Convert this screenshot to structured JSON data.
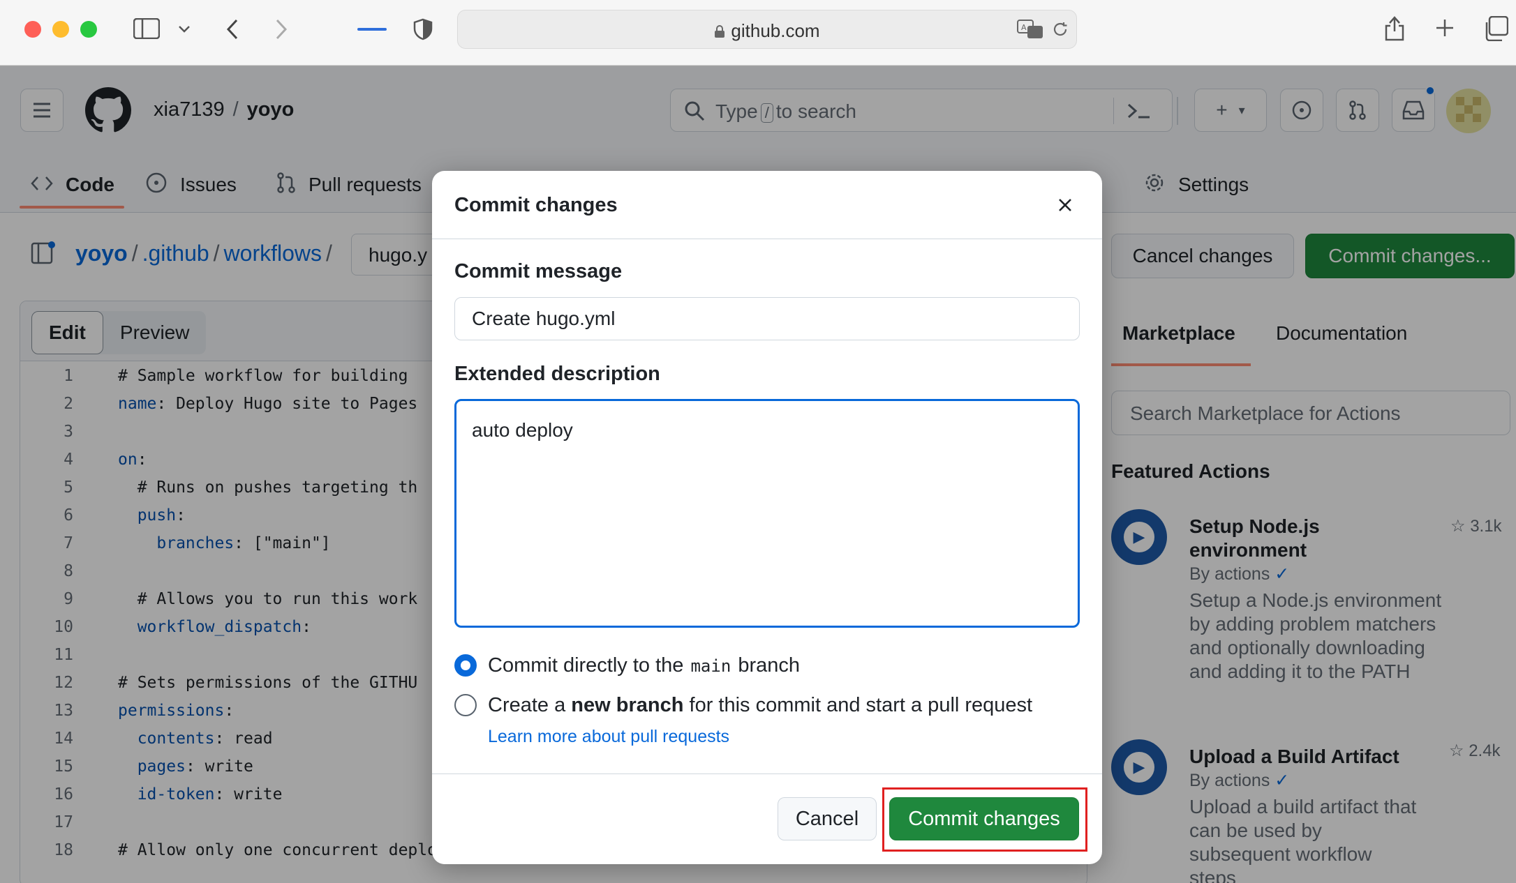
{
  "browser": {
    "url": "github.com"
  },
  "repo": {
    "owner": "xia7139",
    "separator": "/",
    "name": "yoyo"
  },
  "search": {
    "placeholder_before": "Type",
    "slash_key": "/",
    "placeholder_after": "to search"
  },
  "tabs": [
    {
      "label": "Code",
      "icon": "code-icon"
    },
    {
      "label": "Issues",
      "icon": "issue-icon"
    },
    {
      "label": "Pull requests",
      "icon": "pull-request-icon"
    },
    {
      "label": "Settings",
      "icon": "gear-icon"
    }
  ],
  "breadcrumb": {
    "repo": "yoyo",
    "dir1": ".github",
    "dir2": "workflows",
    "sep": "/",
    "filename_visible": "hugo.y"
  },
  "actions": {
    "cancel_changes": "Cancel changes",
    "commit_changes": "Commit changes..."
  },
  "editor": {
    "edit_tab": "Edit",
    "preview_tab": "Preview",
    "lines": [
      {
        "n": "1",
        "text": "# Sample workflow for building"
      },
      {
        "n": "2",
        "key": "name",
        "rest": ": Deploy Hugo site to Pages"
      },
      {
        "n": "3",
        "text": ""
      },
      {
        "n": "4",
        "key": "on",
        "rest": ":"
      },
      {
        "n": "5",
        "text": "  # Runs on pushes targeting th"
      },
      {
        "n": "6",
        "indent": "  ",
        "key": "push",
        "rest": ":"
      },
      {
        "n": "7",
        "indent": "    ",
        "key": "branches",
        "rest": ": [\"main\"]"
      },
      {
        "n": "8",
        "text": ""
      },
      {
        "n": "9",
        "text": "  # Allows you to run this work"
      },
      {
        "n": "10",
        "indent": "  ",
        "key": "workflow_dispatch",
        "rest": ":"
      },
      {
        "n": "11",
        "text": ""
      },
      {
        "n": "12",
        "text": "# Sets permissions of the GITHU"
      },
      {
        "n": "13",
        "key": "permissions",
        "rest": ":"
      },
      {
        "n": "14",
        "indent": "  ",
        "key": "contents",
        "rest": ": read"
      },
      {
        "n": "15",
        "indent": "  ",
        "key": "pages",
        "rest": ": write"
      },
      {
        "n": "16",
        "indent": "  ",
        "key": "id-token",
        "rest": ": write"
      },
      {
        "n": "17",
        "text": ""
      },
      {
        "n": "18",
        "text": "# Allow only one concurrent deployment, skipping runs queued between the run in-progress and"
      }
    ]
  },
  "sidebar": {
    "tab_marketplace": "Marketplace",
    "tab_documentation": "Documentation",
    "search_placeholder": "Search Marketplace for Actions",
    "featured_title": "Featured Actions",
    "items": [
      {
        "name": "Setup Node.js environment",
        "by": "By actions",
        "stars": "3.1k",
        "desc": "Setup a Node.js environment by adding problem matchers and optionally downloading and adding it to the PATH"
      },
      {
        "name": "Upload a Build Artifact",
        "by": "By actions",
        "stars": "2.4k",
        "desc": "Upload a build artifact that can be used by subsequent workflow steps"
      }
    ]
  },
  "modal": {
    "title": "Commit changes",
    "commit_message_label": "Commit message",
    "commit_message_value": "Create hugo.yml",
    "extended_description_label": "Extended description",
    "extended_description_value": "auto deploy",
    "option_direct_before": "Commit directly to the",
    "option_direct_branch": "main",
    "option_direct_after": "branch",
    "option_new_before": "Create a",
    "option_new_bold": "new branch",
    "option_new_after": "for this commit and start a pull request",
    "learn_more": "Learn more about pull requests",
    "cancel": "Cancel",
    "commit": "Commit changes",
    "selected_option": "direct"
  },
  "colors": {
    "primary_green": "#1f883d",
    "accent_blue": "#0969da",
    "tab_underline": "#fd8c73",
    "highlight_red": "#e02020"
  }
}
